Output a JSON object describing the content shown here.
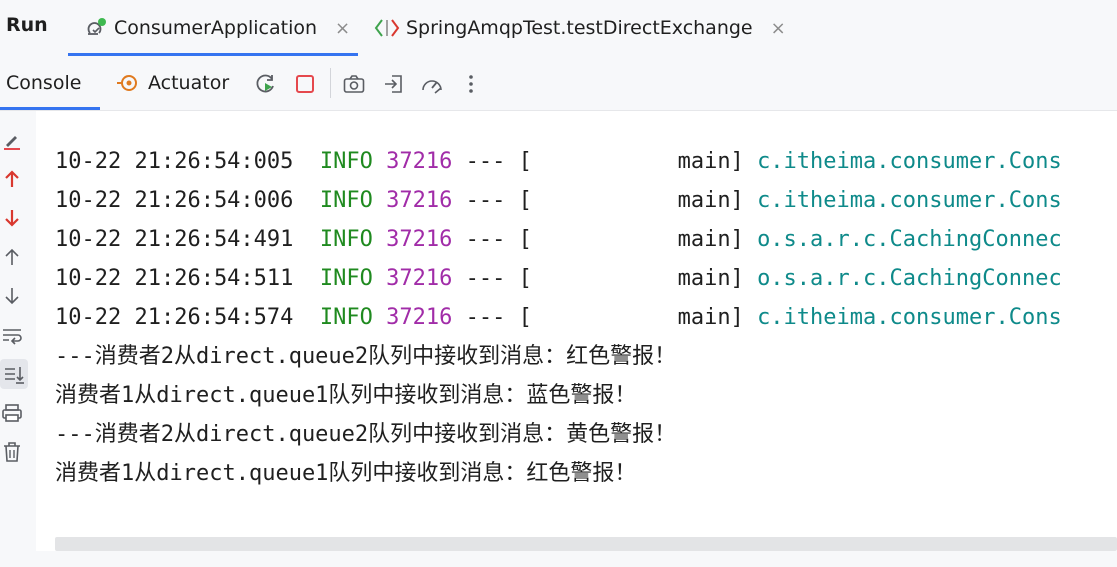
{
  "header": {
    "run_label": "Run",
    "tabs": [
      {
        "label": "ConsumerApplication",
        "icon": "spring-boot-icon",
        "active": true
      },
      {
        "label": "SpringAmqpTest.testDirectExchange",
        "icon": "test-diamond-icon",
        "active": false
      }
    ],
    "close_glyph": "×"
  },
  "toolbar": {
    "console_label": "Console",
    "actuator_label": "Actuator",
    "buttons": [
      "rerun-icon",
      "stop-icon",
      "camera-icon",
      "login-icon",
      "dashboard-icon",
      "more-icon"
    ]
  },
  "gutter": {
    "icons": [
      "edit-icon",
      "up-red-icon",
      "down-red-icon",
      "up-arrow-icon",
      "down-arrow-icon",
      "soft-wrap-icon",
      "scroll-to-end-icon",
      "print-icon",
      "trash-icon"
    ]
  },
  "console": {
    "log_lines": [
      {
        "timestamp": "10-22 21:26:54:005",
        "level": "INFO",
        "pid": "37216",
        "separator": "--- [",
        "thread": "main]",
        "logger": "c.itheima.consumer.Cons"
      },
      {
        "timestamp": "10-22 21:26:54:006",
        "level": "INFO",
        "pid": "37216",
        "separator": "--- [",
        "thread": "main]",
        "logger": "c.itheima.consumer.Cons"
      },
      {
        "timestamp": "10-22 21:26:54:491",
        "level": "INFO",
        "pid": "37216",
        "separator": "--- [",
        "thread": "main]",
        "logger": "o.s.a.r.c.CachingConnec"
      },
      {
        "timestamp": "10-22 21:26:54:511",
        "level": "INFO",
        "pid": "37216",
        "separator": "--- [",
        "thread": "main]",
        "logger": "o.s.a.r.c.CachingConnec"
      },
      {
        "timestamp": "10-22 21:26:54:574",
        "level": "INFO",
        "pid": "37216",
        "separator": "--- [",
        "thread": "main]",
        "logger": "c.itheima.consumer.Cons"
      }
    ],
    "messages": [
      "---消费者2从direct.queue2队列中接收到消息：红色警报！",
      "消费者1从direct.queue1队列中接收到消息：蓝色警报！",
      "---消费者2从direct.queue2队列中接收到消息：黄色警报！",
      "消费者1从direct.queue1队列中接收到消息：红色警报！"
    ]
  },
  "colors": {
    "accent": "#3574f0",
    "info": "#1f8a1f",
    "pid": "#a12ca8",
    "logger": "#0e8a8a",
    "stop": "#e5484d",
    "scroll_red": "#d9382f"
  }
}
